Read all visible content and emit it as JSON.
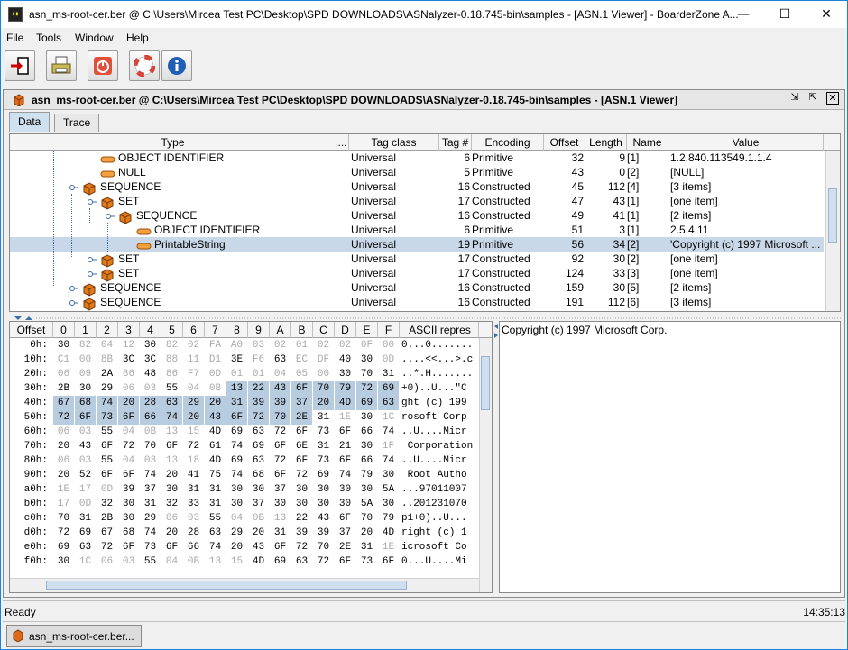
{
  "window": {
    "title": "asn_ms-root-cer.ber @ C:\\Users\\Mircea Test PC\\Desktop\\SPD DOWNLOADS\\ASNalyzer-0.18.745-bin\\samples - [ASN.1 Viewer] - BoarderZone A...",
    "minimize": "—",
    "maximize": "☐",
    "close": "✕"
  },
  "menu": [
    "File",
    "Tools",
    "Window",
    "Help"
  ],
  "toolbar": {
    "buttons": [
      {
        "name": "exit-icon",
        "color": "#cc0000"
      },
      {
        "name": "print-icon",
        "color": "#9a8a2a"
      },
      {
        "name": "power-icon",
        "color": "#e0503a"
      },
      {
        "name": "help-lifebuoy-icon",
        "color": "#e03a2a"
      },
      {
        "name": "info-icon",
        "color": "#1e5fb4"
      }
    ]
  },
  "document": {
    "title": "asn_ms-root-cer.ber @ C:\\Users\\Mircea Test PC\\Desktop\\SPD DOWNLOADS\\ASNalyzer-0.18.745-bin\\samples - [ASN.1 Viewer]",
    "tabs": [
      "Data",
      "Trace"
    ]
  },
  "tree": {
    "columns": [
      "Type",
      "...",
      "Tag class",
      "Tag #",
      "Encoding",
      "Offset",
      "Length",
      "Name",
      "Value"
    ],
    "rows": [
      {
        "indent": 4,
        "icon": "leaf",
        "type": "OBJECT IDENTIFIER",
        "tagclass": "Universal",
        "tag": "6",
        "enc": "Primitive",
        "offset": "32",
        "length": "9",
        "name": "[1]",
        "value": "1.2.840.113549.1.1.4"
      },
      {
        "indent": 4,
        "icon": "leaf",
        "type": "NULL",
        "tagclass": "Universal",
        "tag": "5",
        "enc": "Primitive",
        "offset": "43",
        "length": "0",
        "name": "[2]",
        "value": "[NULL]"
      },
      {
        "indent": 3,
        "icon": "box",
        "type": "SEQUENCE",
        "tagclass": "Universal",
        "tag": "16",
        "enc": "Constructed",
        "offset": "45",
        "length": "112",
        "name": "[4]",
        "value": "[3 items]"
      },
      {
        "indent": 4,
        "icon": "box",
        "type": "SET",
        "tagclass": "Universal",
        "tag": "17",
        "enc": "Constructed",
        "offset": "47",
        "length": "43",
        "name": "[1]",
        "value": "[one item]"
      },
      {
        "indent": 5,
        "icon": "box",
        "type": "SEQUENCE",
        "tagclass": "Universal",
        "tag": "16",
        "enc": "Constructed",
        "offset": "49",
        "length": "41",
        "name": "[1]",
        "value": "[2 items]"
      },
      {
        "indent": 6,
        "icon": "leaf",
        "type": "OBJECT IDENTIFIER",
        "tagclass": "Universal",
        "tag": "6",
        "enc": "Primitive",
        "offset": "51",
        "length": "3",
        "name": "[1]",
        "value": "2.5.4.11"
      },
      {
        "indent": 6,
        "icon": "leaf",
        "type": "PrintableString",
        "tagclass": "Universal",
        "tag": "19",
        "enc": "Primitive",
        "offset": "56",
        "length": "34",
        "name": "[2]",
        "value": "'Copyright (c) 1997 Microsoft ...",
        "selected": true
      },
      {
        "indent": 4,
        "icon": "box",
        "type": "SET",
        "tagclass": "Universal",
        "tag": "17",
        "enc": "Constructed",
        "offset": "92",
        "length": "30",
        "name": "[2]",
        "value": "[one item]"
      },
      {
        "indent": 4,
        "icon": "box",
        "type": "SET",
        "tagclass": "Universal",
        "tag": "17",
        "enc": "Constructed",
        "offset": "124",
        "length": "33",
        "name": "[3]",
        "value": "[one item]"
      },
      {
        "indent": 3,
        "icon": "box",
        "type": "SEQUENCE",
        "tagclass": "Universal",
        "tag": "16",
        "enc": "Constructed",
        "offset": "159",
        "length": "30",
        "name": "[5]",
        "value": "[2 items]"
      },
      {
        "indent": 3,
        "icon": "box",
        "type": "SEQUENCE",
        "tagclass": "Universal",
        "tag": "16",
        "enc": "Constructed",
        "offset": "191",
        "length": "112",
        "name": "[6]",
        "value": "[3 items]"
      }
    ]
  },
  "hex": {
    "columns": [
      "Offset",
      "0",
      "1",
      "2",
      "3",
      "4",
      "5",
      "6",
      "7",
      "8",
      "9",
      "A",
      "B",
      "C",
      "D",
      "E",
      "F",
      "ASCII repres"
    ],
    "rows": [
      {
        "off": "0h:",
        "bytes": [
          "30",
          "82",
          "04",
          "12",
          "30",
          "82",
          "02",
          "FA",
          "A0",
          "03",
          "02",
          "01",
          "02",
          "02",
          "0F",
          "00"
        ],
        "gray": [
          1,
          2,
          3,
          5,
          6,
          7,
          8,
          9,
          10,
          11,
          12,
          13,
          14,
          15
        ],
        "sel": [],
        "ascii": "0...0......."
      },
      {
        "off": "10h:",
        "bytes": [
          "C1",
          "00",
          "8B",
          "3C",
          "3C",
          "88",
          "11",
          "D1",
          "3E",
          "F6",
          "63",
          "EC",
          "DF",
          "40",
          "30",
          "0D"
        ],
        "gray": [
          0,
          1,
          2,
          5,
          6,
          7,
          9,
          11,
          12,
          15
        ],
        "sel": [],
        "ascii": "....<<...>.c"
      },
      {
        "off": "20h:",
        "bytes": [
          "06",
          "09",
          "2A",
          "86",
          "48",
          "86",
          "F7",
          "0D",
          "01",
          "01",
          "04",
          "05",
          "00",
          "30",
          "70",
          "31"
        ],
        "gray": [
          0,
          1,
          3,
          5,
          6,
          7,
          8,
          9,
          10,
          11,
          12
        ],
        "sel": [],
        "ascii": "..*.H......."
      },
      {
        "off": "30h:",
        "bytes": [
          "2B",
          "30",
          "29",
          "06",
          "03",
          "55",
          "04",
          "0B",
          "13",
          "22",
          "43",
          "6F",
          "70",
          "79",
          "72",
          "69"
        ],
        "gray": [
          3,
          4,
          6,
          7
        ],
        "sel": [
          8,
          9,
          10,
          11,
          12,
          13,
          14,
          15
        ],
        "ascii": "+0)..U...\"C"
      },
      {
        "off": "40h:",
        "bytes": [
          "67",
          "68",
          "74",
          "20",
          "28",
          "63",
          "29",
          "20",
          "31",
          "39",
          "39",
          "37",
          "20",
          "4D",
          "69",
          "63"
        ],
        "gray": [],
        "sel": [
          0,
          1,
          2,
          3,
          4,
          5,
          6,
          7,
          8,
          9,
          10,
          11,
          12,
          13,
          14,
          15
        ],
        "ascii": "ght (c) 199"
      },
      {
        "off": "50h:",
        "bytes": [
          "72",
          "6F",
          "73",
          "6F",
          "66",
          "74",
          "20",
          "43",
          "6F",
          "72",
          "70",
          "2E",
          "31",
          "1E",
          "30",
          "1C"
        ],
        "gray": [
          13,
          15
        ],
        "sel": [
          0,
          1,
          2,
          3,
          4,
          5,
          6,
          7,
          8,
          9,
          10,
          11
        ],
        "ascii": "rosoft Corp"
      },
      {
        "off": "60h:",
        "bytes": [
          "06",
          "03",
          "55",
          "04",
          "0B",
          "13",
          "15",
          "4D",
          "69",
          "63",
          "72",
          "6F",
          "73",
          "6F",
          "66",
          "74"
        ],
        "gray": [
          0,
          1,
          3,
          4,
          5,
          6
        ],
        "sel": [],
        "ascii": "..U....Micr"
      },
      {
        "off": "70h:",
        "bytes": [
          "20",
          "43",
          "6F",
          "72",
          "70",
          "6F",
          "72",
          "61",
          "74",
          "69",
          "6F",
          "6E",
          "31",
          "21",
          "30",
          "1F"
        ],
        "gray": [
          15
        ],
        "sel": [],
        "ascii": " Corporation"
      },
      {
        "off": "80h:",
        "bytes": [
          "06",
          "03",
          "55",
          "04",
          "03",
          "13",
          "18",
          "4D",
          "69",
          "63",
          "72",
          "6F",
          "73",
          "6F",
          "66",
          "74"
        ],
        "gray": [
          0,
          1,
          3,
          4,
          5,
          6
        ],
        "sel": [],
        "ascii": "..U....Micr"
      },
      {
        "off": "90h:",
        "bytes": [
          "20",
          "52",
          "6F",
          "6F",
          "74",
          "20",
          "41",
          "75",
          "74",
          "68",
          "6F",
          "72",
          "69",
          "74",
          "79",
          "30"
        ],
        "gray": [],
        "sel": [],
        "ascii": " Root Autho"
      },
      {
        "off": "a0h:",
        "bytes": [
          "1E",
          "17",
          "0D",
          "39",
          "37",
          "30",
          "31",
          "31",
          "30",
          "30",
          "37",
          "30",
          "30",
          "30",
          "30",
          "5A"
        ],
        "gray": [
          0,
          1,
          2
        ],
        "sel": [],
        "ascii": "...97011007"
      },
      {
        "off": "b0h:",
        "bytes": [
          "17",
          "0D",
          "32",
          "30",
          "31",
          "32",
          "33",
          "31",
          "30",
          "37",
          "30",
          "30",
          "30",
          "30",
          "5A",
          "30"
        ],
        "gray": [
          0,
          1
        ],
        "sel": [],
        "ascii": "..201231070"
      },
      {
        "off": "c0h:",
        "bytes": [
          "70",
          "31",
          "2B",
          "30",
          "29",
          "06",
          "03",
          "55",
          "04",
          "0B",
          "13",
          "22",
          "43",
          "6F",
          "70",
          "79"
        ],
        "gray": [
          5,
          6,
          8,
          9,
          10
        ],
        "sel": [],
        "ascii": "p1+0)..U..."
      },
      {
        "off": "d0h:",
        "bytes": [
          "72",
          "69",
          "67",
          "68",
          "74",
          "20",
          "28",
          "63",
          "29",
          "20",
          "31",
          "39",
          "39",
          "37",
          "20",
          "4D"
        ],
        "gray": [],
        "sel": [],
        "ascii": "right (c) 1"
      },
      {
        "off": "e0h:",
        "bytes": [
          "69",
          "63",
          "72",
          "6F",
          "73",
          "6F",
          "66",
          "74",
          "20",
          "43",
          "6F",
          "72",
          "70",
          "2E",
          "31",
          "1E"
        ],
        "gray": [
          15
        ],
        "sel": [],
        "ascii": "icrosoft Co"
      },
      {
        "off": "f0h:",
        "bytes": [
          "30",
          "1C",
          "06",
          "03",
          "55",
          "04",
          "0B",
          "13",
          "15",
          "4D",
          "69",
          "63",
          "72",
          "6F",
          "73",
          "6F"
        ],
        "gray": [
          1,
          2,
          3,
          5,
          6,
          7,
          8
        ],
        "sel": [],
        "ascii": "0...U....Mi"
      }
    ]
  },
  "value_pane": {
    "text": "Copyright (c) 1997 Microsoft Corp."
  },
  "status": {
    "left": "Ready",
    "time": "14:35:13"
  },
  "taskbar": {
    "item": "asn_ms-root-cer.ber..."
  }
}
